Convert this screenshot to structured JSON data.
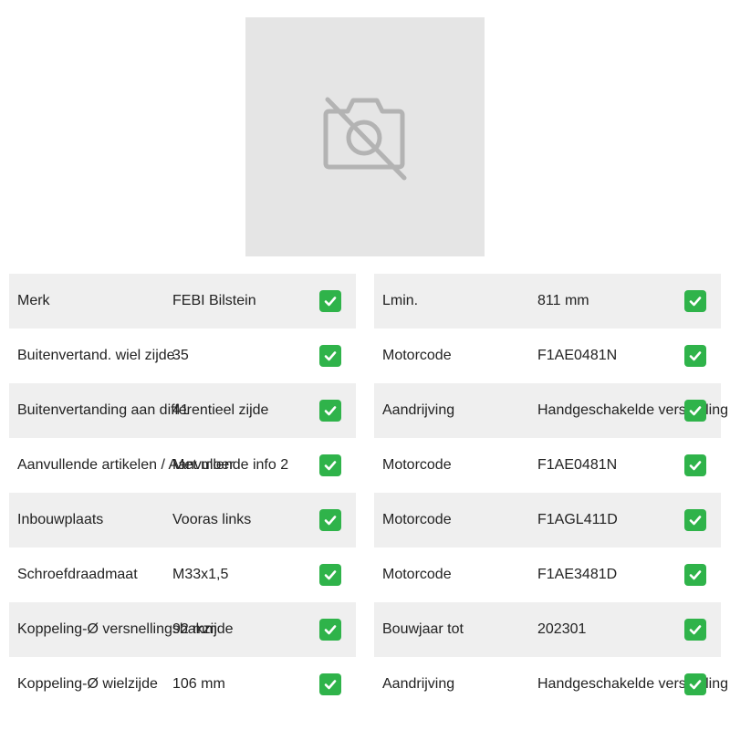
{
  "image_placeholder": {
    "icon": "no-camera-icon"
  },
  "left_table": [
    {
      "label": "Merk",
      "value": "FEBI Bilstein"
    },
    {
      "label": "Buitenvertand. wiel zijde",
      "value": "35"
    },
    {
      "label": "Buitenvertanding aan differentieel zijde",
      "value": "41"
    },
    {
      "label": "Aanvullende artikelen / Aanvullende info 2",
      "value": "Met moer"
    },
    {
      "label": "Inbouwplaats",
      "value": "Vooras links"
    },
    {
      "label": "Schroefdraadmaat",
      "value": "M33x1,5"
    },
    {
      "label": "Koppeling-Ø versnellingsbakzijde",
      "value": "92 mm"
    },
    {
      "label": "Koppeling-Ø wielzijde",
      "value": "106 mm"
    }
  ],
  "right_table": [
    {
      "label": "Lmin.",
      "value": "811 mm"
    },
    {
      "label": "Motorcode",
      "value": "F1AE0481N"
    },
    {
      "label": "Aandrijving",
      "value": "Handgeschakelde versnelling"
    },
    {
      "label": "Motorcode",
      "value": "F1AE0481N"
    },
    {
      "label": "Motorcode",
      "value": "F1AGL411D"
    },
    {
      "label": "Motorcode",
      "value": "F1AE3481D"
    },
    {
      "label": "Bouwjaar tot",
      "value": "202301"
    },
    {
      "label": "Aandrijving",
      "value": "Handgeschakelde versnelling"
    }
  ],
  "check_icon": "check-mark-icon",
  "colors": {
    "row_shade": "#efefef",
    "check_green": "#2fb34a",
    "placeholder_bg": "#e5e5e5",
    "placeholder_icon": "#b3b3b3"
  }
}
